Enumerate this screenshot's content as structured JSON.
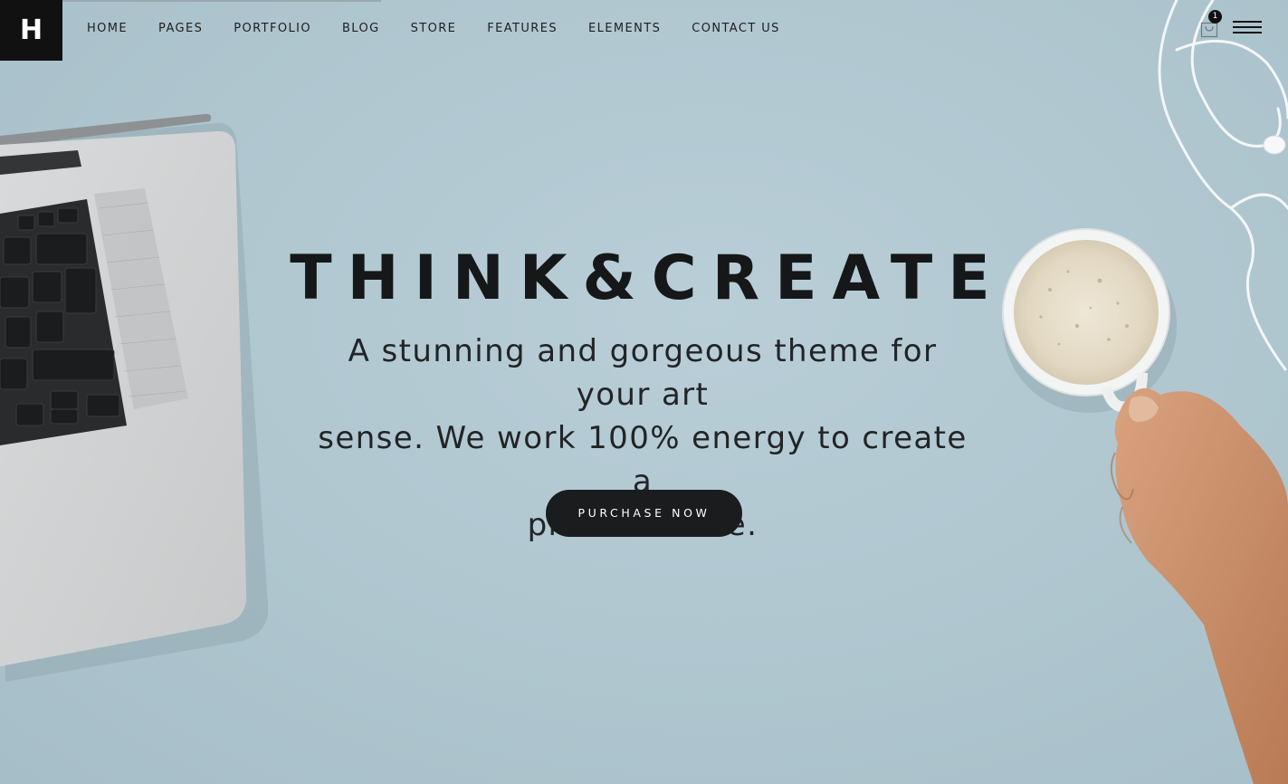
{
  "brand": {
    "logo_letter": "H"
  },
  "nav": {
    "items": [
      {
        "label": "HOME"
      },
      {
        "label": "PAGES"
      },
      {
        "label": "PORTFOLIO"
      },
      {
        "label": "BLOG"
      },
      {
        "label": "STORE"
      },
      {
        "label": "FEATURES"
      },
      {
        "label": "ELEMENTS"
      },
      {
        "label": "CONTACT US"
      }
    ]
  },
  "header_right": {
    "cart_count": "1",
    "cart_icon": "shopping-bag-icon",
    "menu_icon": "hamburger-menu-icon"
  },
  "hero": {
    "title": "THINK&CREATE",
    "subtitle_lines": [
      "A stunning and gorgeous theme for your art",
      "sense. We work 100% energy to create a",
      "premium one."
    ],
    "cta_label": "PURCHASE NOW"
  },
  "colors": {
    "background": "#b4cad3",
    "text": "#151718",
    "button": "#1b1c1d",
    "button_text": "#ffffff",
    "logo_bg": "#111111"
  },
  "scene": {
    "left_object": "laptop-illustration",
    "right_objects": [
      "coffee-cup-illustration",
      "hand-illustration",
      "earphones-illustration"
    ]
  }
}
